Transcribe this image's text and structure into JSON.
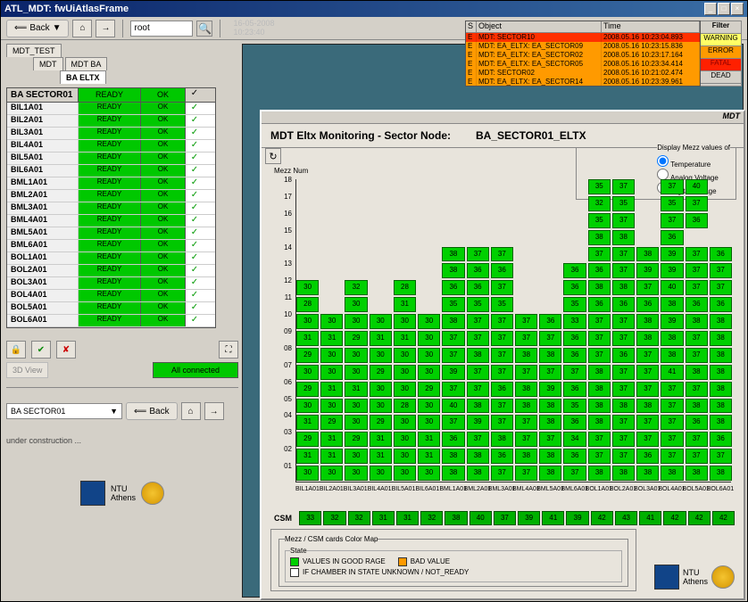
{
  "window": {
    "title": "ATL_MDT: fwUiAtlasFrame"
  },
  "toolbar": {
    "back_label": "Back",
    "root_value": "root",
    "timestamp_date": "16-05-2008",
    "timestamp_time": "10:23:40"
  },
  "alarms": {
    "header_s": "S",
    "header_obj": "Object",
    "header_time": "Time",
    "rows": [
      {
        "s": "E",
        "obj": "MDT: SECTOR10",
        "time": "2008.05.16 10:23:04.893",
        "bg": "#ff3000"
      },
      {
        "s": "E",
        "obj": "MDT: EA_ELTX: EA_SECTOR09",
        "time": "2008.05.16 10:23:15.836",
        "bg": "#ff9a00"
      },
      {
        "s": "E",
        "obj": "MDT: EA_ELTX: EA_SECTOR02",
        "time": "2008.05.16 10:23:17.164",
        "bg": "#ff9a00"
      },
      {
        "s": "E",
        "obj": "MDT: EA_ELTX: EA_SECTOR05",
        "time": "2008.05.16 10:23:34.414",
        "bg": "#ff9a00"
      },
      {
        "s": "E",
        "obj": "MDT: SECTOR02",
        "time": "2008.05.16 10:21:02.474",
        "bg": "#ff9a00"
      },
      {
        "s": "E",
        "obj": "MDT: EA_ELTX: EA_SECTOR14",
        "time": "2008.05.16 10:23:39.961",
        "bg": "#ff9a00"
      }
    ],
    "filter_title": "Filter",
    "filters": [
      {
        "label": "WARNING",
        "bg": "#ffff66"
      },
      {
        "label": "ERROR",
        "bg": "#ff9a00"
      },
      {
        "label": "FATAL",
        "bg": "#ff2000",
        "fg": "#800"
      },
      {
        "label": "DEAD",
        "bg": "#d4d0c8"
      }
    ]
  },
  "tabs": {
    "l1": "MDT_TEST",
    "l2a": "MDT",
    "l2b": "MDT BA",
    "l3": "BA ELTX"
  },
  "sector_header": {
    "name": "BA SECTOR01",
    "state": "READY",
    "status": "OK"
  },
  "sector_rows": [
    {
      "name": "BIL1A01",
      "state": "READY",
      "status": "OK"
    },
    {
      "name": "BIL2A01",
      "state": "READY",
      "status": "OK"
    },
    {
      "name": "BIL3A01",
      "state": "READY",
      "status": "OK"
    },
    {
      "name": "BIL4A01",
      "state": "READY",
      "status": "OK"
    },
    {
      "name": "BIL5A01",
      "state": "READY",
      "status": "OK"
    },
    {
      "name": "BIL6A01",
      "state": "READY",
      "status": "OK"
    },
    {
      "name": "BML1A01",
      "state": "READY",
      "status": "OK"
    },
    {
      "name": "BML2A01",
      "state": "READY",
      "status": "OK"
    },
    {
      "name": "BML3A01",
      "state": "READY",
      "status": "OK"
    },
    {
      "name": "BML4A01",
      "state": "READY",
      "status": "OK"
    },
    {
      "name": "BML5A01",
      "state": "READY",
      "status": "OK"
    },
    {
      "name": "BML6A01",
      "state": "READY",
      "status": "OK"
    },
    {
      "name": "BOL1A01",
      "state": "READY",
      "status": "OK"
    },
    {
      "name": "BOL2A01",
      "state": "READY",
      "status": "OK"
    },
    {
      "name": "BOL3A01",
      "state": "READY",
      "status": "OK"
    },
    {
      "name": "BOL4A01",
      "state": "READY",
      "status": "OK"
    },
    {
      "name": "BOL5A01",
      "state": "READY",
      "status": "OK"
    },
    {
      "name": "BOL6A01",
      "state": "READY",
      "status": "OK"
    }
  ],
  "status": {
    "view3d": "3D View",
    "all_connected": "All connected"
  },
  "nav": {
    "combo": "BA SECTOR01",
    "back": "Back"
  },
  "under_construction": "under construction ...",
  "logos": {
    "ntu": "NTU",
    "athens": "Athens"
  },
  "monitor": {
    "corner": "MDT",
    "title_prefix": "MDT Eltx Monitoring  - Sector Node:",
    "title_node": "BA_SECTOR01_ELTX",
    "display_label": "Display Mezz values of",
    "opt_temp": "Temperature",
    "opt_av": "Analog Voltage",
    "opt_dv": "Digital Voltage",
    "ylabel": "Mezz Num",
    "csm_label": "CSM",
    "legend_box_title": "Mezz / CSM cards Color Map",
    "legend_state": "State",
    "legend_good": "VALUES IN GOOD RAGE",
    "legend_bad": "BAD VALUE",
    "legend_unknown": "IF CHAMBER IN STATE UNKNOWN  /  NOT_READY"
  },
  "chart_data": {
    "type": "heatmap",
    "xlabel": "",
    "ylabel": "Mezz Num",
    "categories": [
      "BIL1A01",
      "BIL2A01",
      "BIL3A01",
      "BIL4A01",
      "BIL5A01",
      "BIL6A01",
      "BML1A01",
      "BML2A01",
      "BML3A01",
      "BML4A01",
      "BML5A01",
      "BML6A01",
      "BOL1A01",
      "BOL2A01",
      "BOL3A01",
      "BOL4A01",
      "BOL5A01",
      "BOL6A01"
    ],
    "y_range": [
      1,
      18
    ],
    "csm": [
      33,
      32,
      32,
      31,
      31,
      32,
      38,
      40,
      37,
      39,
      41,
      39,
      42,
      43,
      41,
      42,
      42,
      42
    ],
    "grid": {
      "18": {
        "13": 35,
        "14": 37,
        "16": 37,
        "17": 40
      },
      "17": {
        "13": 32,
        "14": 35,
        "16": 35,
        "17": 37
      },
      "16": {
        "13": 35,
        "14": 37,
        "16": 37,
        "17": 36
      },
      "15": {
        "13": 38,
        "14": 38,
        "16": 36
      },
      "14": {
        "7": 38,
        "8": 37,
        "9": 37,
        "13": 37,
        "14": 37,
        "15": 38,
        "16": 39,
        "17": 37,
        "18": 36
      },
      "13": {
        "7": 38,
        "8": 36,
        "9": 36,
        "12": 36,
        "13": 36,
        "14": 37,
        "15": 39,
        "16": 39,
        "17": 37,
        "18": 37
      },
      "12": {
        "1": 30,
        "3": 32,
        "5": 28,
        "7": 36,
        "8": 36,
        "9": 37,
        "12": 36,
        "13": 38,
        "14": 38,
        "15": 37,
        "16": 40,
        "17": 37,
        "18": 37
      },
      "11": {
        "1": 28,
        "3": 30,
        "5": 31,
        "7": 35,
        "8": 35,
        "9": 35,
        "12": 35,
        "13": 36,
        "14": 36,
        "15": 36,
        "16": 38,
        "17": 36,
        "18": 36
      },
      "10": {
        "1": 30,
        "2": 30,
        "3": 30,
        "4": 30,
        "5": 30,
        "6": 30,
        "7": 38,
        "8": 37,
        "9": 37,
        "10": 37,
        "11": 36,
        "12": 33,
        "13": 37,
        "14": 37,
        "15": 38,
        "16": 39,
        "17": 38,
        "18": 38
      },
      "09": {
        "1": 31,
        "2": 31,
        "3": 29,
        "4": 31,
        "5": 31,
        "6": 30,
        "7": 37,
        "8": 37,
        "9": 37,
        "10": 37,
        "11": 37,
        "12": 36,
        "13": 37,
        "14": 37,
        "15": 38,
        "16": 38,
        "17": 37,
        "18": 38
      },
      "08": {
        "1": 29,
        "2": 30,
        "3": 30,
        "4": 30,
        "5": 30,
        "6": 30,
        "7": 37,
        "8": 38,
        "9": 37,
        "10": 38,
        "11": 38,
        "12": 36,
        "13": 37,
        "14": 36,
        "15": 37,
        "16": 38,
        "17": 37,
        "18": 38
      },
      "07": {
        "1": 30,
        "2": 30,
        "3": 30,
        "4": 29,
        "5": 30,
        "6": 30,
        "7": 39,
        "8": 37,
        "9": 37,
        "10": 37,
        "11": 37,
        "12": 37,
        "13": 38,
        "14": 37,
        "15": 37,
        "16": 41,
        "17": 38,
        "18": 38
      },
      "06": {
        "1": 29,
        "2": 31,
        "3": 31,
        "4": 30,
        "5": 30,
        "6": 29,
        "7": 37,
        "8": 37,
        "9": 36,
        "10": 38,
        "11": 39,
        "12": 36,
        "13": 38,
        "14": 37,
        "15": 37,
        "16": 37,
        "17": 37,
        "18": 38
      },
      "05": {
        "1": 30,
        "2": 30,
        "3": 30,
        "4": 30,
        "5": 28,
        "6": 30,
        "7": 40,
        "8": 38,
        "9": 37,
        "10": 38,
        "11": 38,
        "12": 35,
        "13": 38,
        "14": 38,
        "15": 38,
        "16": 37,
        "17": 38,
        "18": 38
      },
      "04": {
        "1": 31,
        "2": 29,
        "3": 30,
        "4": 29,
        "5": 30,
        "6": 30,
        "7": 37,
        "8": 39,
        "9": 37,
        "10": 37,
        "11": 38,
        "12": 36,
        "13": 38,
        "14": 37,
        "15": 37,
        "16": 37,
        "17": 36,
        "18": 38
      },
      "03": {
        "1": 29,
        "2": 31,
        "3": 29,
        "4": 31,
        "5": 30,
        "6": 31,
        "7": 36,
        "8": 37,
        "9": 38,
        "10": 37,
        "11": 37,
        "12": 34,
        "13": 37,
        "14": 37,
        "15": 37,
        "16": 37,
        "17": 37,
        "18": 36
      },
      "02": {
        "1": 31,
        "2": 31,
        "3": 30,
        "4": 31,
        "5": 30,
        "6": 31,
        "7": 38,
        "8": 38,
        "9": 36,
        "10": 38,
        "11": 38,
        "12": 36,
        "13": 37,
        "14": 37,
        "15": 36,
        "16": 37,
        "17": 37,
        "18": 37
      },
      "01": {
        "1": 30,
        "2": 30,
        "3": 30,
        "4": 30,
        "5": 30,
        "6": 30,
        "7": 38,
        "8": 38,
        "9": 37,
        "10": 37,
        "11": 38,
        "12": 37,
        "13": 38,
        "14": 38,
        "15": 38,
        "16": 38,
        "17": 38,
        "18": 38
      }
    }
  }
}
